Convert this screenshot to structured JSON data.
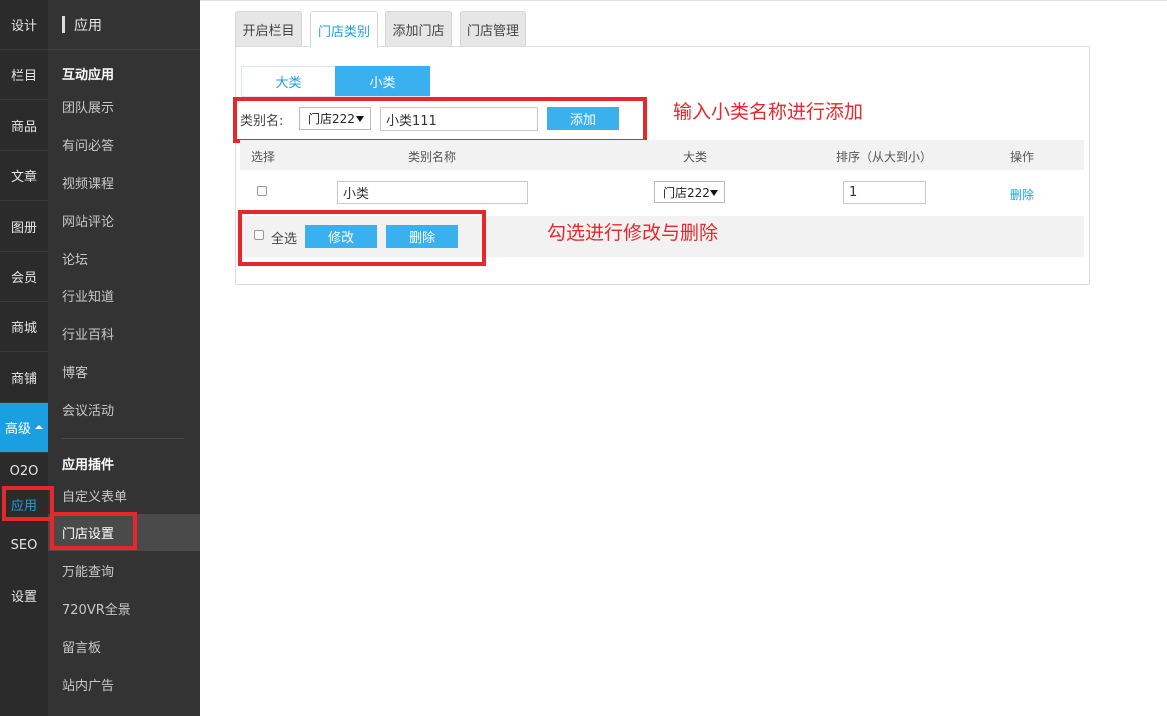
{
  "nav_primary": [
    {
      "id": "design",
      "label": "设计"
    },
    {
      "id": "column",
      "label": "栏目"
    },
    {
      "id": "goods",
      "label": "商品"
    },
    {
      "id": "article",
      "label": "文章"
    },
    {
      "id": "album",
      "label": "图册"
    },
    {
      "id": "member",
      "label": "会员"
    },
    {
      "id": "mall",
      "label": "商城"
    },
    {
      "id": "shop",
      "label": "商铺"
    },
    {
      "id": "advanced",
      "label": "高级"
    },
    {
      "id": "o2o",
      "label": "O2O"
    },
    {
      "id": "app",
      "label": "应用"
    },
    {
      "id": "seo",
      "label": "SEO"
    },
    {
      "id": "settings",
      "label": "设置"
    }
  ],
  "nav_secondary": {
    "header": "应用",
    "section1_title": "互动应用",
    "section1_items": [
      "团队展示",
      "有问必答",
      "视频课程",
      "网站评论",
      "论坛",
      "行业知道",
      "行业百科",
      "博客",
      "会议活动"
    ],
    "section2_title": "应用插件",
    "section2_items": [
      "自定义表单",
      "门店设置",
      "万能查询",
      "720VR全景",
      "留言板",
      "站内广告"
    ]
  },
  "tabs": [
    "开启栏目",
    "门店类别",
    "添加门店",
    "门店管理"
  ],
  "subtabs": {
    "big": "大类",
    "small": "小类"
  },
  "form": {
    "label": "类别名:",
    "select_value": "门店222",
    "input_value": "小类111",
    "add_button": "添加"
  },
  "table": {
    "headers": [
      "选择",
      "类别名称",
      "大类",
      "排序（从大到小）",
      "操作"
    ],
    "rows": [
      {
        "name": "小类",
        "category": "门店222",
        "order": "1",
        "action": "删除"
      }
    ]
  },
  "footer": {
    "select_all": "全选",
    "modify_button": "修改",
    "delete_button": "删除"
  },
  "annotations": {
    "add_hint": "输入小类名称进行添加",
    "edit_hint": "勾选进行修改与删除"
  },
  "colors": {
    "accent": "#1aa0e0",
    "button": "#3ab0ef",
    "annotation": "#e8272d",
    "sidebar": "#2b2b2b"
  }
}
